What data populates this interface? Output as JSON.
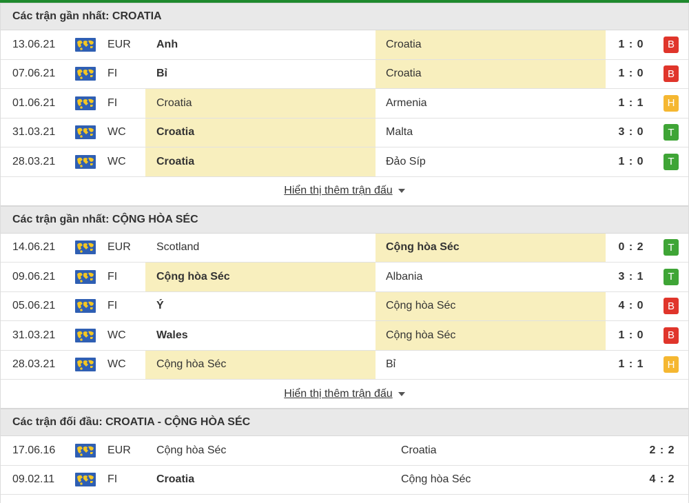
{
  "colors": {
    "accent_bar": "#1f8a2e",
    "highlight": "#f8efbe",
    "loss": "#e0352b",
    "draw": "#f5b731",
    "win": "#3fa536"
  },
  "icons": {
    "league_flag": "world-map-flag-icon",
    "more_caret": "caret-down-icon"
  },
  "section1": {
    "title": "Các trận gần nhất: CROATIA",
    "more_label": "Hiển thị thêm trận đấu",
    "rows": [
      {
        "date": "13.06.21",
        "league": "EUR",
        "home": "Anh",
        "away": "Croatia",
        "score": "1 : 0",
        "result": "B"
      },
      {
        "date": "07.06.21",
        "league": "FI",
        "home": "Bỉ",
        "away": "Croatia",
        "score": "1 : 0",
        "result": "B"
      },
      {
        "date": "01.06.21",
        "league": "FI",
        "home": "Croatia",
        "away": "Armenia",
        "score": "1 : 1",
        "result": "H"
      },
      {
        "date": "31.03.21",
        "league": "WC",
        "home": "Croatia",
        "away": "Malta",
        "score": "3 : 0",
        "result": "T"
      },
      {
        "date": "28.03.21",
        "league": "WC",
        "home": "Croatia",
        "away": "Đảo Síp",
        "score": "1 : 0",
        "result": "T"
      }
    ]
  },
  "section2": {
    "title": "Các trận gần nhất: CỘNG HÒA SÉC",
    "more_label": "Hiển thị thêm trận đấu",
    "rows": [
      {
        "date": "14.06.21",
        "league": "EUR",
        "home": "Scotland",
        "away": "Cộng hòa Séc",
        "score": "0 : 2",
        "result": "T"
      },
      {
        "date": "09.06.21",
        "league": "FI",
        "home": "Cộng hòa Séc",
        "away": "Albania",
        "score": "3 : 1",
        "result": "T"
      },
      {
        "date": "05.06.21",
        "league": "FI",
        "home": "Ý",
        "away": "Cộng hòa Séc",
        "score": "4 : 0",
        "result": "B"
      },
      {
        "date": "31.03.21",
        "league": "WC",
        "home": "Wales",
        "away": "Cộng hòa Séc",
        "score": "1 : 0",
        "result": "B"
      },
      {
        "date": "28.03.21",
        "league": "WC",
        "home": "Cộng hòa Séc",
        "away": "Bỉ",
        "score": "1 : 1",
        "result": "H"
      }
    ]
  },
  "section3": {
    "title": "Các trận đối đầu: CROATIA - CỘNG HÒA SÉC",
    "rows": [
      {
        "date": "17.06.16",
        "league": "EUR",
        "home": "Cộng hòa Séc",
        "away": "Croatia",
        "score": "2 : 2"
      },
      {
        "date": "09.02.11",
        "league": "FI",
        "home": "Croatia",
        "away": "Cộng hòa Séc",
        "score": "4 : 2"
      }
    ]
  }
}
